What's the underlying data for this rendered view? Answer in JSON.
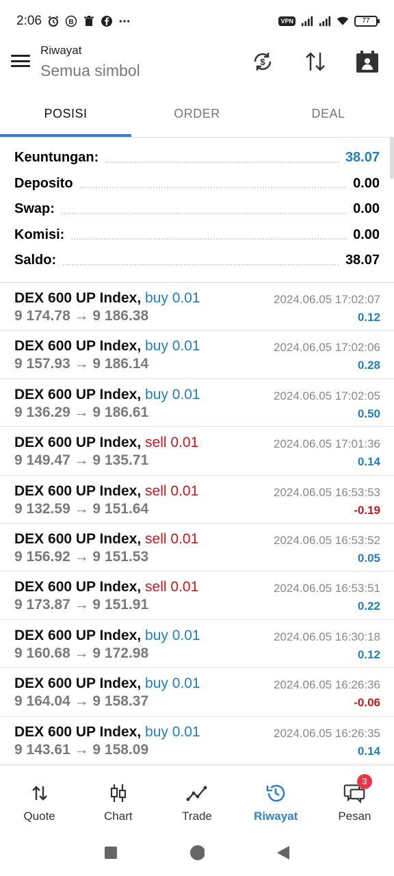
{
  "status_bar": {
    "time": "2:06",
    "notif_icons": [
      "alarm-icon",
      "b-icon",
      "trash-icon",
      "facebook-icon",
      "more-dots-icon"
    ],
    "vpn_label": "VPN",
    "battery": "77"
  },
  "app_bar": {
    "title": "Riwayat",
    "subtitle": "Semua simbol"
  },
  "tabs": [
    {
      "label": "POSISI",
      "active": true
    },
    {
      "label": "ORDER",
      "active": false
    },
    {
      "label": "DEAL",
      "active": false
    }
  ],
  "summary": [
    {
      "label": "Keuntungan:",
      "value": "38.07"
    },
    {
      "label": "Deposito",
      "value": "0.00"
    },
    {
      "label": "Swap:",
      "value": "0.00"
    },
    {
      "label": "Komisi:",
      "value": "0.00"
    },
    {
      "label": "Saldo:",
      "value": "38.07"
    }
  ],
  "deals": [
    {
      "symbol": "DEX 600 UP Index,",
      "side": "buy 0.01",
      "prices": "9 174.78 → 9 186.38",
      "time": "2024.06.05 17:02:07",
      "profit": "0.12"
    },
    {
      "symbol": "DEX 600 UP Index,",
      "side": "buy 0.01",
      "prices": "9 157.93 → 9 186.14",
      "time": "2024.06.05 17:02:06",
      "profit": "0.28"
    },
    {
      "symbol": "DEX 600 UP Index,",
      "side": "buy 0.01",
      "prices": "9 136.29 → 9 186.61",
      "time": "2024.06.05 17:02:05",
      "profit": "0.50"
    },
    {
      "symbol": "DEX 600 UP Index,",
      "side": "sell 0.01",
      "prices": "9 149.47 → 9 135.71",
      "time": "2024.06.05 17:01:36",
      "profit": "0.14"
    },
    {
      "symbol": "DEX 600 UP Index,",
      "side": "sell 0.01",
      "prices": "9 132.59 → 9 151.64",
      "time": "2024.06.05 16:53:53",
      "profit": "-0.19"
    },
    {
      "symbol": "DEX 600 UP Index,",
      "side": "sell 0.01",
      "prices": "9 156.92 → 9 151.53",
      "time": "2024.06.05 16:53:52",
      "profit": "0.05"
    },
    {
      "symbol": "DEX 600 UP Index,",
      "side": "sell 0.01",
      "prices": "9 173.87 → 9 151.91",
      "time": "2024.06.05 16:53:51",
      "profit": "0.22"
    },
    {
      "symbol": "DEX 600 UP Index,",
      "side": "buy 0.01",
      "prices": "9 160.68 → 9 172.98",
      "time": "2024.06.05 16:30:18",
      "profit": "0.12"
    },
    {
      "symbol": "DEX 600 UP Index,",
      "side": "buy 0.01",
      "prices": "9 164.04 → 9 158.37",
      "time": "2024.06.05 16:26:36",
      "profit": "-0.06"
    },
    {
      "symbol": "DEX 600 UP Index,",
      "side": "buy 0.01",
      "prices": "9 143.61 → 9 158.09",
      "time": "2024.06.05 16:26:35",
      "profit": "0.14"
    }
  ],
  "bottom_nav": [
    {
      "label": "Quote",
      "icon": "quote-arrows-icon"
    },
    {
      "label": "Chart",
      "icon": "candlestick-icon"
    },
    {
      "label": "Trade",
      "icon": "trade-line-icon"
    },
    {
      "label": "Riwayat",
      "icon": "history-icon",
      "active": true
    },
    {
      "label": "Pesan",
      "icon": "messages-icon",
      "badge": "3"
    }
  ],
  "colors": {
    "accent": "#2f80d0",
    "buy": "#1f7fc2",
    "sell": "#c8161d",
    "badge": "#e53945"
  }
}
